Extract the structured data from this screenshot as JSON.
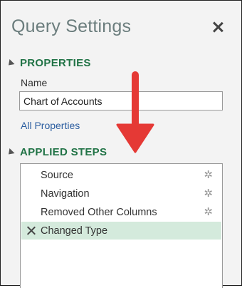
{
  "panel": {
    "title": "Query Settings",
    "close_icon": "close-icon"
  },
  "properties": {
    "heading": "PROPERTIES",
    "name_label": "Name",
    "name_value": "Chart of Accounts",
    "all_properties_link": "All Properties"
  },
  "applied_steps": {
    "heading": "APPLIED STEPS",
    "steps": [
      {
        "label": "Source",
        "icon": "gear-icon",
        "selected": false
      },
      {
        "label": "Navigation",
        "icon": "gear-icon",
        "selected": false
      },
      {
        "label": "Removed Other Columns",
        "icon": "gear-icon",
        "selected": false
      },
      {
        "label": "Changed Type",
        "icon": "delete-step-icon",
        "selected": true
      }
    ]
  },
  "annotation": {
    "arrow_color": "#e53935"
  }
}
